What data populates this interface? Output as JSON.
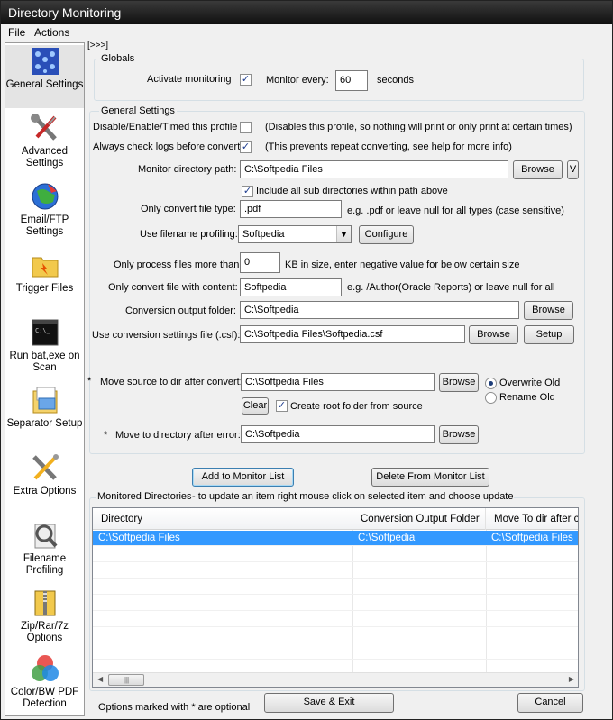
{
  "window": {
    "title": "Directory Monitoring"
  },
  "menu": {
    "file": "File",
    "actions": "Actions"
  },
  "nav_toggle": "[>>>]",
  "sidebar": {
    "items": [
      {
        "label": "General Settings",
        "icon": "general-settings-icon"
      },
      {
        "label": "Advanced Settings",
        "icon": "wrench-screwdriver-icon"
      },
      {
        "label": "Email/FTP Settings",
        "icon": "globe-icon"
      },
      {
        "label": "Trigger Files",
        "icon": "trigger-folder-icon"
      },
      {
        "label": "Run bat,exe on Scan",
        "icon": "console-icon"
      },
      {
        "label": "Separator Setup",
        "icon": "separator-icon"
      },
      {
        "label": "Extra Options",
        "icon": "tools-icon"
      },
      {
        "label": "Filename Profiling",
        "icon": "filename-profiling-icon"
      },
      {
        "label": "Zip/Rar/7z Options",
        "icon": "archive-icon"
      },
      {
        "label": "Color/BW PDF Detection",
        "icon": "color-circles-icon"
      }
    ]
  },
  "globals": {
    "title": "Globals",
    "activate_label": "Activate monitoring",
    "activate_checked": true,
    "monitor_every_label": "Monitor every:",
    "monitor_every_value": "60",
    "seconds_label": "seconds"
  },
  "general": {
    "title": "General Settings",
    "disable_label": "Disable/Enable/Timed this profile",
    "disable_checked": false,
    "disable_note": "(Disables this profile, so nothing will print or only print at certain times)",
    "check_logs_label": "Always check logs before convert",
    "check_logs_checked": true,
    "check_logs_note": "(This prevents repeat converting, see help for more info)",
    "monitor_path_label": "Monitor directory path:",
    "monitor_path_value": "C:\\Softpedia Files",
    "browse_label": "Browse",
    "v_label": "V",
    "include_sub_label": "Include all sub directories within path above",
    "include_sub_checked": true,
    "file_type_label": "Only convert file type:",
    "file_type_value": ".pdf",
    "file_type_note": "e.g. .pdf or leave null for all types (case sensitive)",
    "profiling_label": "Use filename profiling:",
    "profiling_value": "Softpedia",
    "configure_label": "Configure",
    "size_label": "Only process files more than:",
    "size_value": "0",
    "size_note": "KB in size, enter negative value for below certain size",
    "content_label": "Only convert file with content:",
    "content_value": "Softpedia",
    "content_note": "e.g. /Author(Oracle Reports) or leave null for all",
    "output_folder_label": "Conversion output folder:",
    "output_folder_value": "C:\\Softpedia",
    "csf_label": "Use conversion settings file (.csf):",
    "csf_value": "C:\\Softpedia Files\\Softpedia.csf",
    "setup_label": "Setup",
    "move_source_star": "*",
    "move_source_label": "Move source to dir after convert:",
    "move_source_value": "C:\\Softpedia Files",
    "overwrite_label": "Overwrite Old",
    "rename_label": "Rename Old",
    "clear_label": "Clear",
    "create_root_label": "Create root folder from source",
    "create_root_checked": true,
    "move_error_star": "*",
    "move_error_label": "Move to directory after error:",
    "move_error_value": "C:\\Softpedia"
  },
  "actions": {
    "add_label": "Add to Monitor List",
    "delete_label": "Delete From Monitor List"
  },
  "monitored": {
    "title": "Monitored Directories",
    "hint": "-   to update an item right mouse click on selected item and choose update",
    "columns": [
      "Directory",
      "Conversion Output Folder",
      "Move To dir after co"
    ],
    "rows": [
      [
        "C:\\Softpedia Files",
        "C:\\Softpedia",
        "C:\\Softpedia Files"
      ]
    ]
  },
  "footer": {
    "optional_note": "Options marked with * are optional",
    "save_label": "Save & Exit",
    "cancel_label": "Cancel"
  },
  "colors": {
    "titlebar": "#101010",
    "selection": "#3399ff",
    "focus_border": "#3c7fb1"
  }
}
